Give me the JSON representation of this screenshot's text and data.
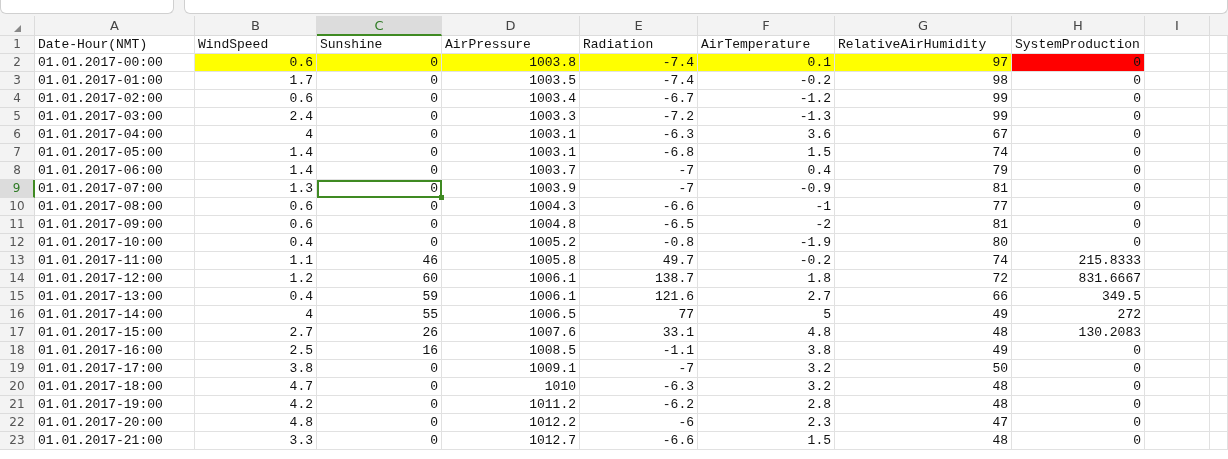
{
  "columns": [
    {
      "label": "A",
      "selected": false
    },
    {
      "label": "B",
      "selected": false
    },
    {
      "label": "C",
      "selected": true
    },
    {
      "label": "D",
      "selected": false
    },
    {
      "label": "E",
      "selected": false
    },
    {
      "label": "F",
      "selected": false
    },
    {
      "label": "G",
      "selected": false
    },
    {
      "label": "H",
      "selected": false
    },
    {
      "label": "I",
      "selected": false
    }
  ],
  "rows": [
    {
      "number": "1",
      "kind": "header",
      "selected": false,
      "cells": [
        "Date-Hour(NMT)",
        "WindSpeed",
        "Sunshine",
        "AirPressure",
        "Radiation",
        "AirTemperature",
        "RelativeAirHumidity",
        "SystemProduction"
      ]
    },
    {
      "number": "2",
      "kind": "data",
      "selected": false,
      "cells": [
        "01.01.2017-00:00",
        {
          "text": "0.6",
          "color": "#ffff00"
        },
        {
          "text": "0",
          "color": "#ffff00"
        },
        {
          "text": "1003.8",
          "color": "#ffff00"
        },
        {
          "text": "-7.4",
          "color": "#ffff00"
        },
        {
          "text": "0.1",
          "color": "#ffff00"
        },
        {
          "text": "97",
          "color": "#ffff00"
        },
        {
          "text": "0",
          "color": "#ff0000"
        }
      ]
    },
    {
      "number": "3",
      "kind": "data",
      "selected": false,
      "cells": [
        "01.01.2017-01:00",
        "1.7",
        "0",
        "1003.5",
        "-7.4",
        "-0.2",
        "98",
        "0"
      ]
    },
    {
      "number": "4",
      "kind": "data",
      "selected": false,
      "cells": [
        "01.01.2017-02:00",
        "0.6",
        "0",
        "1003.4",
        "-6.7",
        "-1.2",
        "99",
        "0"
      ]
    },
    {
      "number": "5",
      "kind": "data",
      "selected": false,
      "cells": [
        "01.01.2017-03:00",
        "2.4",
        "0",
        "1003.3",
        "-7.2",
        "-1.3",
        "99",
        "0"
      ]
    },
    {
      "number": "6",
      "kind": "data",
      "selected": false,
      "cells": [
        "01.01.2017-04:00",
        "4",
        "0",
        "1003.1",
        "-6.3",
        "3.6",
        "67",
        "0"
      ]
    },
    {
      "number": "7",
      "kind": "data",
      "selected": false,
      "cells": [
        "01.01.2017-05:00",
        "1.4",
        "0",
        "1003.1",
        "-6.8",
        "1.5",
        "74",
        "0"
      ]
    },
    {
      "number": "8",
      "kind": "data",
      "selected": false,
      "cells": [
        "01.01.2017-06:00",
        "1.4",
        "0",
        "1003.7",
        "-7",
        "0.4",
        "79",
        "0"
      ]
    },
    {
      "number": "9",
      "kind": "data",
      "selected": true,
      "cells": [
        "01.01.2017-07:00",
        "1.3",
        "0",
        "1003.9",
        "-7",
        "-0.9",
        "81",
        "0"
      ]
    },
    {
      "number": "10",
      "kind": "data",
      "selected": false,
      "cells": [
        "01.01.2017-08:00",
        "0.6",
        "0",
        "1004.3",
        "-6.6",
        "-1",
        "77",
        "0"
      ]
    },
    {
      "number": "11",
      "kind": "data",
      "selected": false,
      "cells": [
        "01.01.2017-09:00",
        "0.6",
        "0",
        "1004.8",
        "-6.5",
        "-2",
        "81",
        "0"
      ]
    },
    {
      "number": "12",
      "kind": "data",
      "selected": false,
      "cells": [
        "01.01.2017-10:00",
        "0.4",
        "0",
        "1005.2",
        "-0.8",
        "-1.9",
        "80",
        "0"
      ]
    },
    {
      "number": "13",
      "kind": "data",
      "selected": false,
      "cells": [
        "01.01.2017-11:00",
        "1.1",
        "46",
        "1005.8",
        "49.7",
        "-0.2",
        "74",
        "215.8333"
      ]
    },
    {
      "number": "14",
      "kind": "data",
      "selected": false,
      "cells": [
        "01.01.2017-12:00",
        "1.2",
        "60",
        "1006.1",
        "138.7",
        "1.8",
        "72",
        "831.6667"
      ]
    },
    {
      "number": "15",
      "kind": "data",
      "selected": false,
      "cells": [
        "01.01.2017-13:00",
        "0.4",
        "59",
        "1006.1",
        "121.6",
        "2.7",
        "66",
        "349.5"
      ]
    },
    {
      "number": "16",
      "kind": "data",
      "selected": false,
      "cells": [
        "01.01.2017-14:00",
        "4",
        "55",
        "1006.5",
        "77",
        "5",
        "49",
        "272"
      ]
    },
    {
      "number": "17",
      "kind": "data",
      "selected": false,
      "cells": [
        "01.01.2017-15:00",
        "2.7",
        "26",
        "1007.6",
        "33.1",
        "4.8",
        "48",
        "130.2083"
      ]
    },
    {
      "number": "18",
      "kind": "data",
      "selected": false,
      "cells": [
        "01.01.2017-16:00",
        "2.5",
        "16",
        "1008.5",
        "-1.1",
        "3.8",
        "49",
        "0"
      ]
    },
    {
      "number": "19",
      "kind": "data",
      "selected": false,
      "cells": [
        "01.01.2017-17:00",
        "3.8",
        "0",
        "1009.1",
        "-7",
        "3.2",
        "50",
        "0"
      ]
    },
    {
      "number": "20",
      "kind": "data",
      "selected": false,
      "cells": [
        "01.01.2017-18:00",
        "4.7",
        "0",
        "1010",
        "-6.3",
        "3.2",
        "48",
        "0"
      ]
    },
    {
      "number": "21",
      "kind": "data",
      "selected": false,
      "cells": [
        "01.01.2017-19:00",
        "4.2",
        "0",
        "1011.2",
        "-6.2",
        "2.8",
        "48",
        "0"
      ]
    },
    {
      "number": "22",
      "kind": "data",
      "selected": false,
      "cells": [
        "01.01.2017-20:00",
        "4.8",
        "0",
        "1012.2",
        "-6",
        "2.3",
        "47",
        "0"
      ]
    },
    {
      "number": "23",
      "kind": "data",
      "selected": false,
      "cells": [
        "01.01.2017-21:00",
        "3.3",
        "0",
        "1012.7",
        "-6.6",
        "1.5",
        "48",
        "0"
      ]
    }
  ]
}
